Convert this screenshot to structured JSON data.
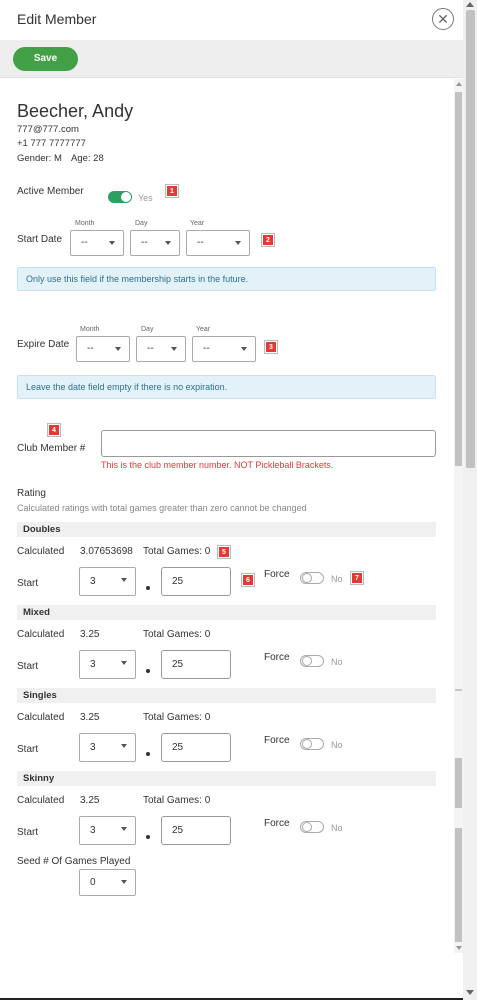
{
  "header": {
    "title": "Edit Member",
    "close_icon": "close-icon"
  },
  "toolbar": {
    "save_label": "Save"
  },
  "member": {
    "name": "Beecher, Andy",
    "email": "777@777.com",
    "phone": "+1 777 7777777",
    "gender_label": "Gender: M",
    "age_label": "Age: 28"
  },
  "active": {
    "label": "Active Member",
    "value": "Yes",
    "on": true
  },
  "start_date": {
    "label": "Start Date",
    "month_label": "Month",
    "day_label": "Day",
    "year_label": "Year",
    "month": "--",
    "day": "--",
    "year": "--",
    "info": "Only use this field if the membership starts in the future."
  },
  "expire_date": {
    "label": "Expire Date",
    "month_label": "Month",
    "day_label": "Day",
    "year_label": "Year",
    "month": "--",
    "day": "--",
    "year": "--",
    "info": "Leave the date field empty if there is no expiration."
  },
  "club_member": {
    "label": "Club Member #",
    "value": "",
    "error": "This is the club member number. NOT Pickleball Brackets."
  },
  "rating": {
    "label": "Rating",
    "hint": "Calculated ratings with total games greater than zero cannot be changed",
    "calculated_label": "Calculated",
    "start_label": "Start",
    "force_label": "Force",
    "sections": [
      {
        "title": "Doubles",
        "calculated": "3.07653698",
        "total_games": "Total Games: 0",
        "start_int": "3",
        "start_dec": "25",
        "force": "No"
      },
      {
        "title": "Mixed",
        "calculated": "3.25",
        "total_games": "Total Games: 0",
        "start_int": "3",
        "start_dec": "25",
        "force": "No"
      },
      {
        "title": "Singles",
        "calculated": "3.25",
        "total_games": "Total Games: 0",
        "start_int": "3",
        "start_dec": "25",
        "force": "No"
      },
      {
        "title": "Skinny",
        "calculated": "3.25",
        "total_games": "Total Games: 0",
        "start_int": "3",
        "start_dec": "25",
        "force": "No"
      }
    ]
  },
  "seed": {
    "label": "Seed # Of Games Played",
    "value": "0"
  },
  "badges": [
    "1",
    "2",
    "3",
    "4",
    "5",
    "6",
    "7"
  ],
  "colors": {
    "save_green": "#43a047",
    "toggle_green": "#2e9e62",
    "badge_red": "#e53935",
    "info_blue_bg": "#e3f2f9"
  }
}
